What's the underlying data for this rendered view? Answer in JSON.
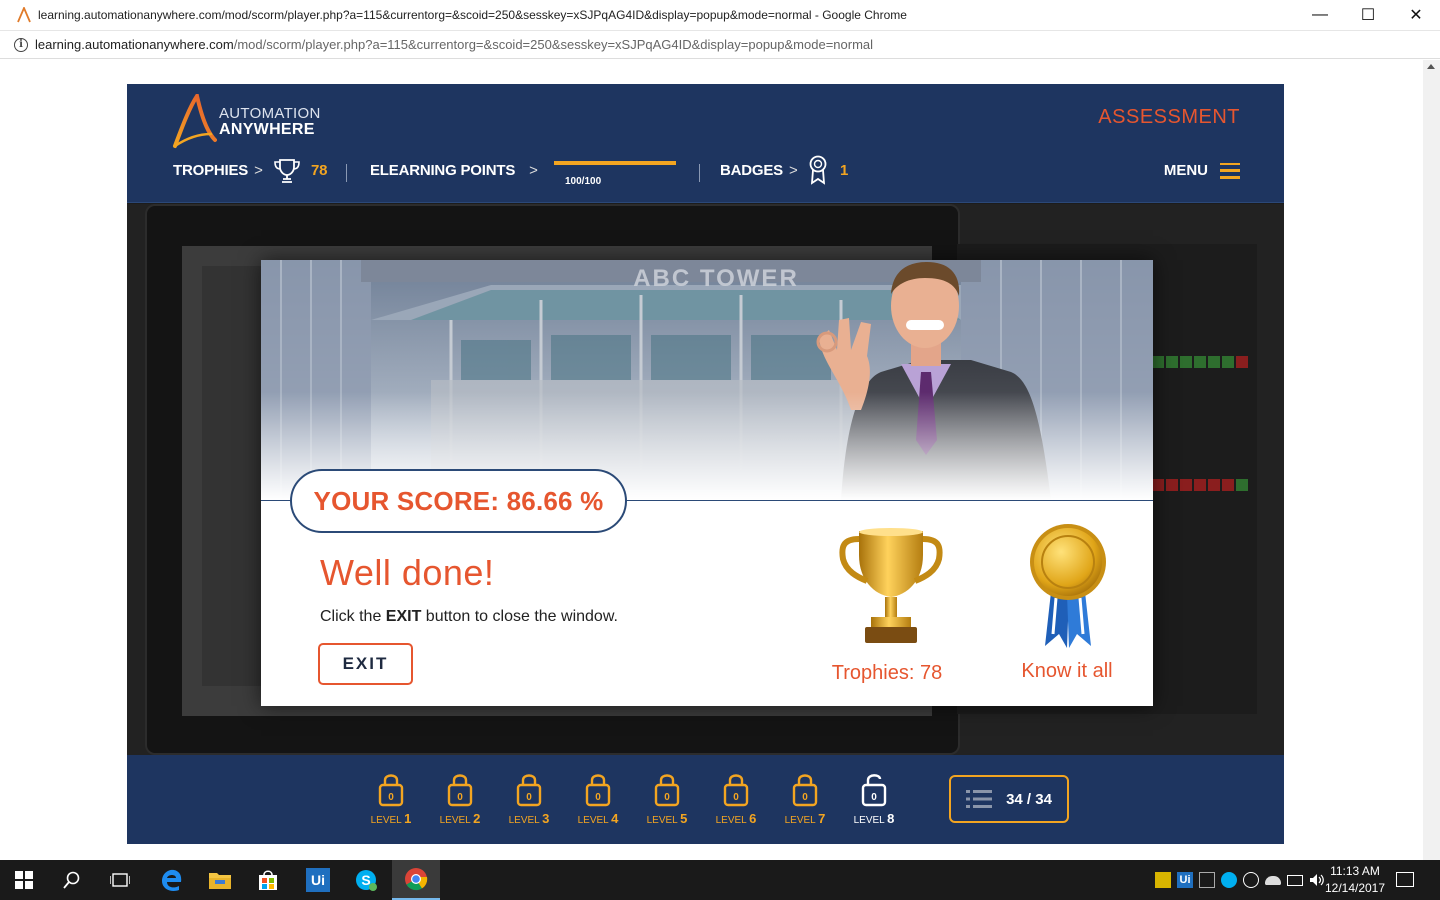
{
  "window": {
    "title": "learning.automationanywhere.com/mod/scorm/player.php?a=115&currentorg=&scoid=250&sesskey=xSJPqAG4ID&display=popup&mode=normal - Google Chrome",
    "minimize_glyph": "—",
    "maximize_glyph": "☐",
    "close_glyph": "✕"
  },
  "address": {
    "info_glyph": "i",
    "host": "learning.automationanywhere.com",
    "path": "/mod/scorm/player.php?a=115&currentorg=&scoid=250&sesskey=xSJPqAG4ID&display=popup&mode=normal"
  },
  "header": {
    "logo_line1": "AUTOMATION",
    "logo_line2": "ANYWHERE",
    "assessment": "ASSESSMENT",
    "trophies_label": "TROPHIES",
    "trophies_count": "78",
    "elearning_label": "ELEARNING POINTS",
    "points_progress": 1.0,
    "points_text": "100/100",
    "badges_label": "BADGES",
    "badges_count": "1",
    "menu_label": "MENU",
    "chevron": ">"
  },
  "scene": {
    "building_sign": "ABC TOWER"
  },
  "result": {
    "score_text": "YOUR SCORE: 86.66 %",
    "headline": "Well done!",
    "instruction_pre": "Click the ",
    "instruction_bold": "EXIT",
    "instruction_post": " button to close the window.",
    "exit_button": "EXIT",
    "trophies_text": "Trophies: 78",
    "badge_text": "Know it all"
  },
  "footer": {
    "level_word": "LEVEL",
    "levels": [
      {
        "num": "1",
        "lock_value": "0",
        "state": "locked"
      },
      {
        "num": "2",
        "lock_value": "0",
        "state": "locked"
      },
      {
        "num": "3",
        "lock_value": "0",
        "state": "locked"
      },
      {
        "num": "4",
        "lock_value": "0",
        "state": "locked"
      },
      {
        "num": "5",
        "lock_value": "0",
        "state": "locked"
      },
      {
        "num": "6",
        "lock_value": "0",
        "state": "locked"
      },
      {
        "num": "7",
        "lock_value": "0",
        "state": "locked"
      },
      {
        "num": "8",
        "lock_value": "0",
        "state": "unlocked"
      }
    ],
    "page_counter": "34 / 34"
  },
  "taskbar": {
    "time": "11:13 AM",
    "date": "12/14/2017",
    "uipath_label": "Ui"
  },
  "colors": {
    "navy": "#1e3560",
    "orange_accent": "#e6562f",
    "gold": "#f3a521"
  }
}
